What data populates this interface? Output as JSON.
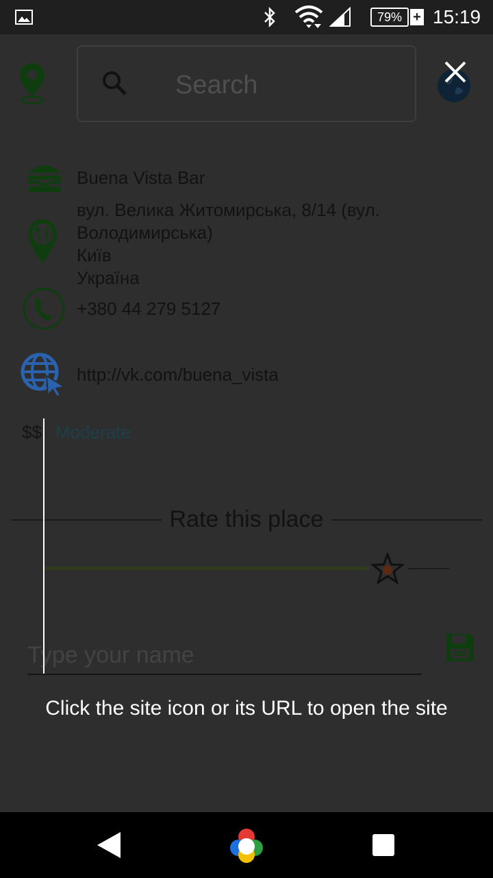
{
  "status_bar": {
    "battery": "79%",
    "battery_plus": "+",
    "time": "15:19",
    "icons": [
      "gallery-icon",
      "bluetooth-icon",
      "wifi-icon",
      "signal-icon",
      "battery-icon"
    ]
  },
  "search": {
    "placeholder": "Search"
  },
  "place": {
    "name": "Buena Vista Bar",
    "address_line1": "вул. Велика Житомирська, 8/14 (вул.",
    "address_line2": "Володимирська)",
    "city": "Київ",
    "country": "Україна",
    "phone": "+380 44 279 5127",
    "website": "http://vk.com/buena_vista",
    "price_symbol": "$$",
    "price_label": "Moderate"
  },
  "rating": {
    "title": "Rate this place",
    "level": 0.8
  },
  "review": {
    "name_placeholder": "Type your name"
  },
  "hint": {
    "text": "Click the site icon or its URL to open the site"
  },
  "colors": {
    "background": "#2e2e2e",
    "accent_green": "#0f3d0f",
    "link_blue": "#1d3f4a",
    "web_icon_blue": "#2a62b0"
  }
}
